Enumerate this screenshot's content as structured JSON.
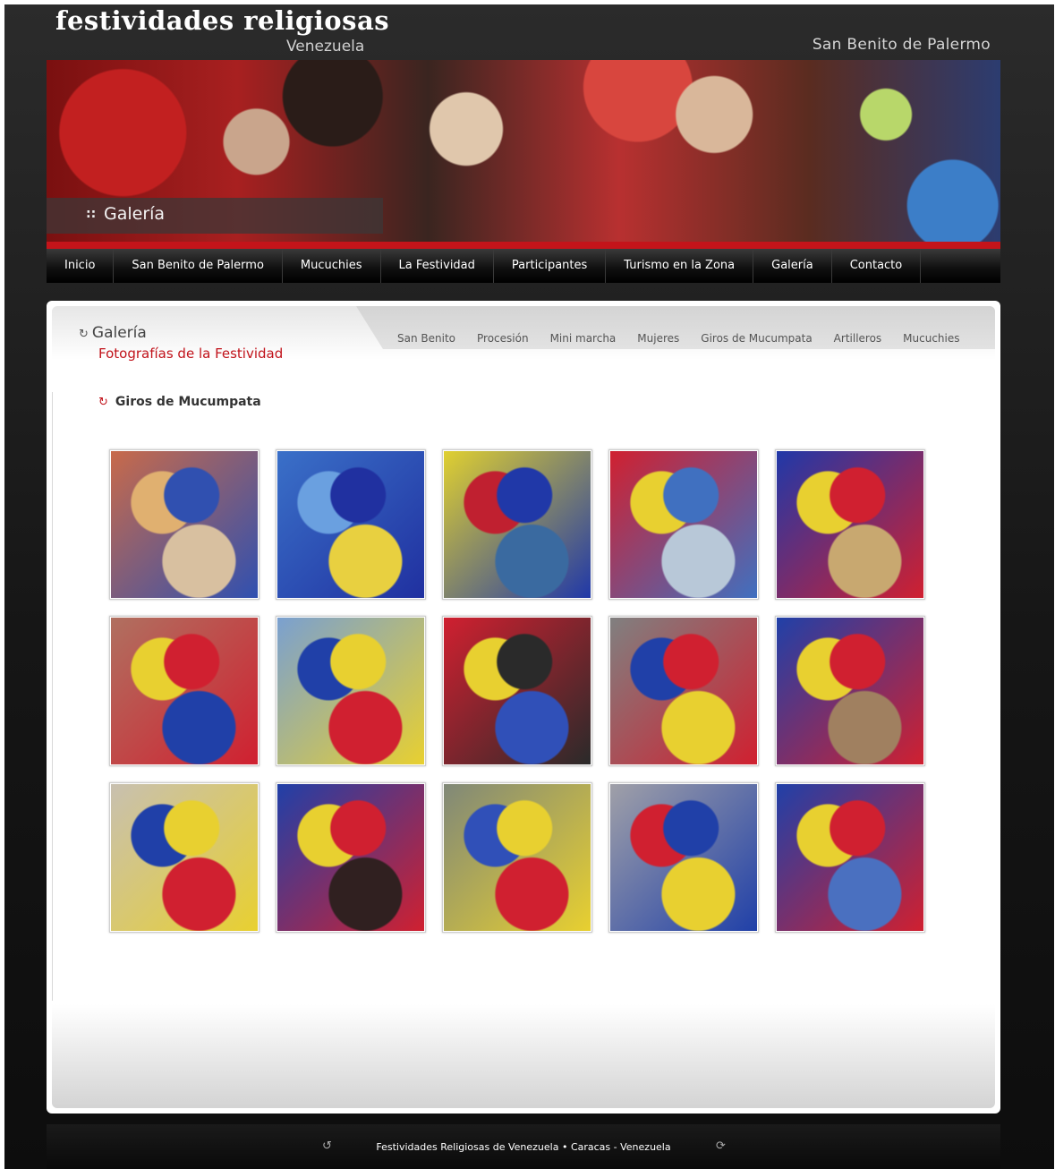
{
  "site": {
    "logo_main": "festividades religiosas",
    "logo_sub": "Venezuela",
    "subtitle": "San Benito de Palermo"
  },
  "banner": {
    "bullet": "::",
    "label": "Galería"
  },
  "nav": {
    "items": [
      "Inicio",
      "San Benito de Palermo",
      "Mucuchies",
      "La Festividad",
      "Participantes",
      "Turismo en la Zona",
      "Galería",
      "Contacto"
    ]
  },
  "content": {
    "heading": "Galería",
    "subheading": "Fotografías de la Festividad",
    "subnav": [
      "San Benito",
      "Procesión",
      "Mini marcha",
      "Mujeres",
      "Giros de Mucumpata",
      "Artilleros",
      "Mucuchies"
    ],
    "section_title": "Giros de Mucumpata"
  },
  "gallery": {
    "photo_count": 15
  },
  "footer": {
    "text": "Festividades Religiosas de Venezuela • Caracas - Venezuela",
    "prev_icon": "↺",
    "next_icon": "⟳"
  },
  "colors": {
    "accent_red": "#c1121a",
    "nav_bg": "#111111",
    "page_bg": "#1c1c1c"
  }
}
